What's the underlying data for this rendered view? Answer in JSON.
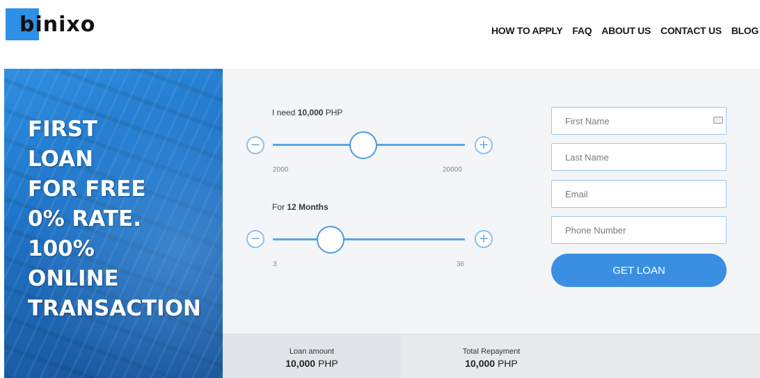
{
  "brand": {
    "name": "binixo",
    "accent": "#2e8fe6"
  },
  "nav": {
    "items": [
      "HOW TO APPLY",
      "FAQ",
      "ABOUT US",
      "CONTACT US",
      "BLOG"
    ]
  },
  "hero": {
    "lines": [
      "FIRST",
      "LOAN",
      "FOR FREE",
      "0% RATE.",
      "100%",
      "ONLINE",
      "TRANSACTION"
    ]
  },
  "amount_slider": {
    "label_prefix": "I need",
    "value": "10,000",
    "unit": "PHP",
    "min": "2000",
    "max": "20000",
    "level": 0.47
  },
  "term_slider": {
    "label_prefix": "For",
    "value": "12 Months",
    "min": "3",
    "max": "36",
    "level": 0.3
  },
  "form": {
    "first_name_placeholder": "First Name",
    "last_name_placeholder": "Last Name",
    "email_placeholder": "Email",
    "phone_placeholder": "Phone Number",
    "submit_label": "GET LOAN"
  },
  "summary": {
    "loan_amount_label": "Loan amount",
    "loan_amount_value": "10,000",
    "loan_amount_unit": "PHP",
    "total_repayment_label": "Total Repayment",
    "total_repayment_value": "10,000",
    "total_repayment_unit": "PHP"
  },
  "icons": {
    "minus": "minus-icon",
    "plus": "plus-icon",
    "card": "contact-card-icon"
  }
}
